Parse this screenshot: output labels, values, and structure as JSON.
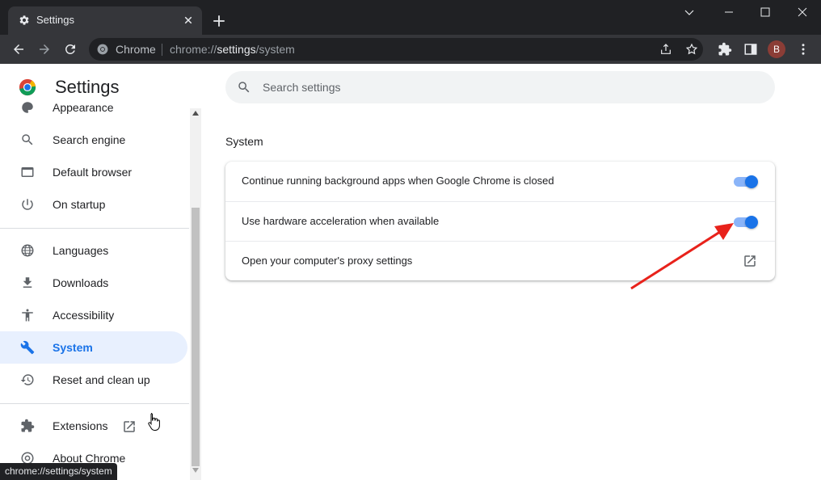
{
  "tab": {
    "title": "Settings"
  },
  "omnibox": {
    "chip": "Chrome",
    "url_scheme": "chrome://",
    "url_host": "settings",
    "url_path": "/system"
  },
  "profile": {
    "initial": "B"
  },
  "header": {
    "title": "Settings"
  },
  "search": {
    "placeholder": "Search settings"
  },
  "sidebar": {
    "items": [
      {
        "label": "Appearance",
        "icon": "palette-icon"
      },
      {
        "label": "Search engine",
        "icon": "search-icon"
      },
      {
        "label": "Default browser",
        "icon": "browser-icon"
      },
      {
        "label": "On startup",
        "icon": "power-icon"
      },
      {
        "label": "Languages",
        "icon": "globe-icon"
      },
      {
        "label": "Downloads",
        "icon": "download-icon"
      },
      {
        "label": "Accessibility",
        "icon": "accessibility-icon"
      },
      {
        "label": "System",
        "icon": "wrench-icon",
        "active": true
      },
      {
        "label": "Reset and clean up",
        "icon": "restore-icon"
      },
      {
        "label": "Extensions",
        "icon": "puzzle-icon"
      },
      {
        "label": "About Chrome",
        "icon": "chrome-icon"
      }
    ]
  },
  "main": {
    "section_title": "System",
    "rows": [
      {
        "label": "Continue running background apps when Google Chrome is closed",
        "toggle": true
      },
      {
        "label": "Use hardware acceleration when available",
        "toggle": true
      },
      {
        "label": "Open your computer's proxy settings"
      }
    ]
  },
  "status_bar": {
    "text": "chrome://settings/system"
  },
  "colors": {
    "accent": "#1a73e8",
    "toggle_track": "#8ab4f8",
    "annotation_arrow": "#e8221b",
    "tabbar": "#202124"
  }
}
